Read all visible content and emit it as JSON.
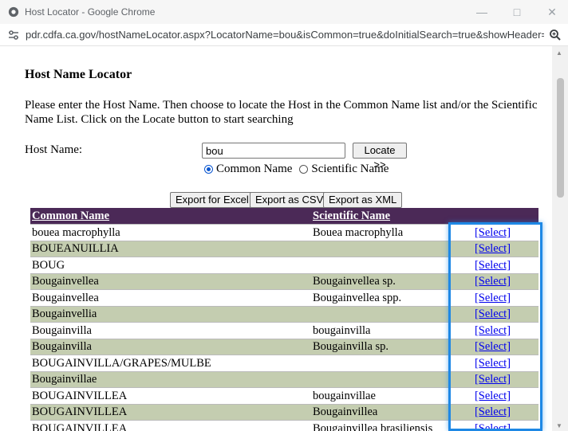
{
  "window": {
    "title": "Host Locator - Google Chrome",
    "url": "pdr.cdfa.ca.gov/hostNameLocator.aspx?LocatorName=bou&isCommon=true&doInitialSearch=true&showHeader=false..."
  },
  "page": {
    "heading": "Host Name Locator",
    "intro": "Please enter the Host Name. Then choose to locate the Host in the Common Name list and/or the Scientific Name List. Click on the Locate button to start searching",
    "host_label": "Host Name:",
    "host_value": "bou",
    "locate_label": "Locate >>",
    "radio_common": "Common Name",
    "radio_scientific": "Scientific Name",
    "export_excel": "Export for Excel",
    "export_csv": "Export as CSV",
    "export_xml": "Export as XML"
  },
  "table": {
    "headers": [
      "Common Name",
      "Scientific Name",
      ""
    ],
    "select_label": "[Select]",
    "rows": [
      {
        "common": "bouea macrophylla",
        "scientific": "Bouea macrophylla"
      },
      {
        "common": "BOUEANUILLIA",
        "scientific": ""
      },
      {
        "common": "BOUG",
        "scientific": ""
      },
      {
        "common": "Bougainvellea",
        "scientific": "Bougainvellea sp."
      },
      {
        "common": "Bougainvellea",
        "scientific": "Bougainvellea spp."
      },
      {
        "common": "Bougainvellia",
        "scientific": ""
      },
      {
        "common": "Bougainvilla",
        "scientific": "bougainvilla"
      },
      {
        "common": "Bougainvilla",
        "scientific": "Bougainvilla sp."
      },
      {
        "common": "BOUGAINVILLA/GRAPES/MULBE",
        "scientific": ""
      },
      {
        "common": "Bougainvillae",
        "scientific": ""
      },
      {
        "common": "BOUGAINVILLEA",
        "scientific": "bougainvillae"
      },
      {
        "common": "BOUGAINVILLEA",
        "scientific": "Bougainvillea"
      },
      {
        "common": "BOUGAINVILLEA",
        "scientific": "Bougainvillea brasiliensis"
      }
    ]
  },
  "colors": {
    "header_bg": "#4b2957",
    "alt_row_bg": "#c4cdb0",
    "highlight": "#1e88e5"
  }
}
